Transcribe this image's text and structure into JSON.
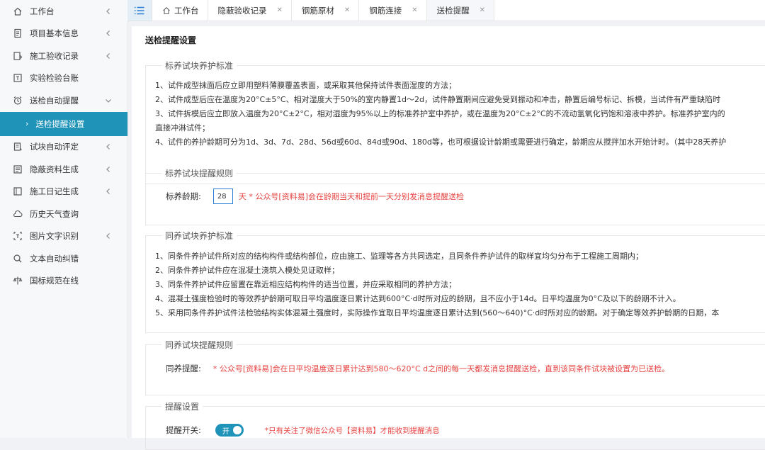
{
  "sidebar": {
    "items": [
      {
        "label": "工作台",
        "icon": "home-icon"
      },
      {
        "label": "项目基本信息",
        "icon": "info-doc-icon"
      },
      {
        "label": "施工验收记录",
        "icon": "record-icon"
      },
      {
        "label": "实验检验台账",
        "icon": "lab-ledger-icon"
      },
      {
        "label": "送检自动提醒",
        "icon": "alarm-clock-icon"
      },
      {
        "label": "送检提醒设置",
        "icon": "chevron-right-icon"
      },
      {
        "label": "试块自动评定",
        "icon": "evaluate-icon"
      },
      {
        "label": "隐蔽资料生成",
        "icon": "document-icon"
      },
      {
        "label": "施工日记生成",
        "icon": "diary-icon"
      },
      {
        "label": "历史天气查询",
        "icon": "weather-icon"
      },
      {
        "label": "图片文字识别",
        "icon": "ocr-icon"
      },
      {
        "label": "文本自动纠错",
        "icon": "spellcheck-icon"
      },
      {
        "label": "国标规范在线",
        "icon": "standard-icon"
      }
    ]
  },
  "tabs": [
    {
      "label": "工作台"
    },
    {
      "label": "隐蔽验收记录"
    },
    {
      "label": "钢筋原材"
    },
    {
      "label": "钢筋连接"
    },
    {
      "label": "送检提醒"
    }
  ],
  "page": {
    "title": "送检提醒设置",
    "section1": {
      "legend": "标养试块养护标准",
      "lines": [
        "1、试件成型抹面后应立即用塑料薄膜覆盖表面，或采取其他保持试件表面湿度的方法；",
        "2、试件成型后应在温度为20°C±5°C、相对湿度大于50%的室内静置1d～2d，试件静置期间应避免受到振动和冲击，静置后编号标记、拆模，当试件有严重缺陷时",
        "3、试件拆模后应立即放入温度为20°C±2°C，相对湿度为95%以上的标准养护室中养护，或在温度为20°C±2°C的不流动氢氧化钙饱和溶液中养护。标准养护室内的",
        "直接冲淋试件；",
        "4、试件的养护龄期可分为1d、3d、7d、28d、56d或60d、84d或90d、180d等，也可根据设计龄期或需要进行确定，龄期应从搅拌加水开始计时。（其中28天养护"
      ]
    },
    "section2": {
      "legend": "标养试块提醒规则",
      "label": "标养龄期:",
      "value": "28",
      "note": "天 * 公众号[资料易]会在龄期当天和提前一天分别发消息提醒送检"
    },
    "section3": {
      "legend": "同养试块养护标准",
      "lines": [
        "1、同条件养护试件所对应的结构构件或结构部位，应由施工、监理等各方共同选定，且同条件养护试件的取样宜均匀分布于工程施工周期内；",
        "2、同条件养护试件应在混凝土浇筑入模处见证取样；",
        "3、同条件养护试件应留置在靠近相应结构构件的适当位置，并应采取相同的养护方法；",
        "4、混凝土强度检验时的等效养护龄期可取日平均温度逐日累计达到600°C·d时所对应的龄期，且不应小于14d。日平均温度为0°C及以下的龄期不计入。",
        "5、采用同条件养护试件法检验结构实体混凝土强度时，实际操作宜取日平均温度逐日累计达到(560～640)°C·d时所对应的龄期。对于确定等效养护龄期的日期，本"
      ]
    },
    "section4": {
      "legend": "同养试块提醒规则",
      "label": "同养提醒:",
      "note": "* 公众号[资料易]会在日平均温度逐日累计达到580～620°C d之间的每一天都发消息提醒送检，直到该同条件试块被设置为已送检。"
    },
    "section5": {
      "legend": "提醒设置",
      "label": "提醒开关:",
      "toggle": "开",
      "note": "*只有关注了微信公众号【资料易】才能收到提醒消息"
    }
  },
  "colors": {
    "accent": "#1f93b8",
    "warning": "#e64340",
    "input_border": "#2a7fd4"
  }
}
